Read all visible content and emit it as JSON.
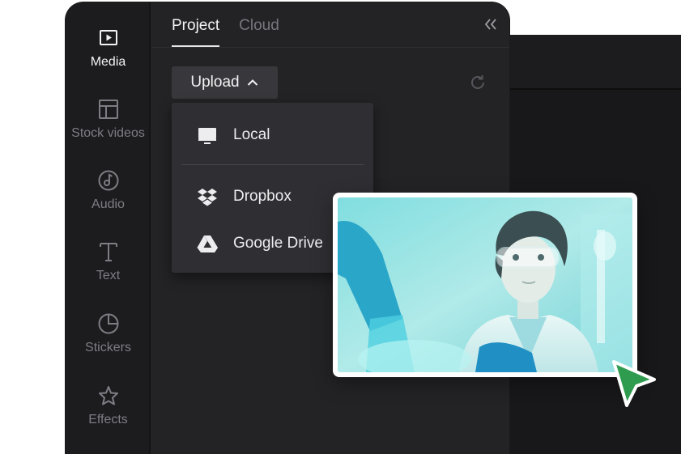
{
  "sidebar": {
    "items": [
      {
        "label": "Media",
        "icon": "media-icon",
        "active": true
      },
      {
        "label": "Stock videos",
        "icon": "stock-videos-icon",
        "active": false
      },
      {
        "label": "Audio",
        "icon": "audio-icon",
        "active": false
      },
      {
        "label": "Text",
        "icon": "text-icon",
        "active": false
      },
      {
        "label": "Stickers",
        "icon": "stickers-icon",
        "active": false
      },
      {
        "label": "Effects",
        "icon": "effects-icon",
        "active": false
      }
    ]
  },
  "tabs": [
    {
      "label": "Project",
      "active": true
    },
    {
      "label": "Cloud",
      "active": false
    }
  ],
  "upload": {
    "label": "Upload",
    "icon": "chevron-up-icon",
    "expanded": true
  },
  "upload_menu": [
    {
      "label": "Local",
      "icon": "monitor-icon"
    },
    {
      "label": "Dropbox",
      "icon": "dropbox-icon"
    },
    {
      "label": "Google Drive",
      "icon": "google-drive-icon"
    }
  ],
  "icons": {
    "collapse": "double-chevron-left-icon",
    "refresh": "refresh-icon",
    "cursor": "pointer-cursor-icon"
  },
  "photo": {
    "subject": "scientist in safety goggles and blue gloves"
  },
  "colors": {
    "panel_bg": "#232326",
    "sidebar_bg": "#1c1c1f",
    "menu_bg": "#2f2f33",
    "cursor_green": "#2e9b4f",
    "photo_tint": "#5fd3d8"
  }
}
